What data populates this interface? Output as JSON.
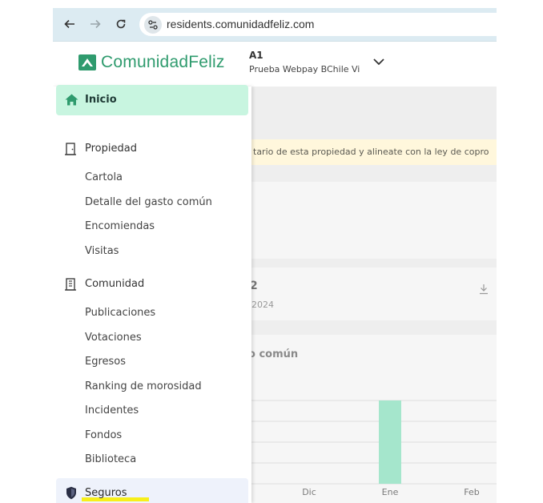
{
  "browser": {
    "back_icon": "arrow-left-icon",
    "forward_icon": "arrow-right-icon",
    "reload_icon": "reload-icon",
    "site_info_icon": "tune-icon",
    "url": "residents.comunidadfeliz.com"
  },
  "header": {
    "logo_text": "ComunidadFeliz",
    "brand_color": "#2f9b6e",
    "unit_title": "A1",
    "unit_subtitle": "Prueba Webpay BChile Vi"
  },
  "sidebar": {
    "active_item": {
      "label": "Inicio",
      "icon": "home-icon"
    },
    "sections": [
      {
        "label": "Propiedad",
        "icon": "door-icon",
        "items": [
          "Cartola",
          "Detalle del gasto común",
          "Encomiendas",
          "Visitas"
        ]
      },
      {
        "label": "Comunidad",
        "icon": "building-icon",
        "items": [
          "Publicaciones",
          "Votaciones",
          "Egresos",
          "Ranking de morosidad",
          "Incidentes",
          "Fondos",
          "Biblioteca"
        ]
      }
    ],
    "last_item": {
      "label": "Seguros",
      "icon": "shield-icon"
    }
  },
  "content": {
    "banner_text": "tario de esta propiedad y alineate con la ley de copro",
    "card_number": "2",
    "card_date": "-2024",
    "chart_title": "o común"
  },
  "chart_data": {
    "type": "bar",
    "categories": [
      "Dic",
      "Ene",
      "Feb"
    ],
    "values": [
      0,
      1,
      0
    ],
    "bar_color": "#a5e6cc",
    "grid": true,
    "title": "",
    "xlabel": "",
    "ylabel": ""
  }
}
